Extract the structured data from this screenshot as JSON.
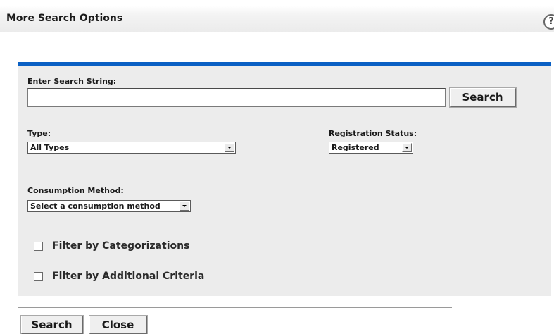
{
  "header": {
    "title": "More Search Options",
    "help_icon": "?"
  },
  "search": {
    "label": "Enter Search String:",
    "value": "",
    "placeholder": "",
    "button_label": "Search"
  },
  "type": {
    "label": "Type:",
    "selected": "All Types"
  },
  "registration_status": {
    "label": "Registration Status:",
    "selected": "Registered"
  },
  "consumption_method": {
    "label": "Consumption Method:",
    "selected": "Select a consumption method"
  },
  "filters": [
    {
      "label": "Filter by Categorizations",
      "checked": false
    },
    {
      "label": "Filter by Additional Criteria",
      "checked": false
    }
  ],
  "footer": {
    "search_label": "Search",
    "close_label": "Close"
  },
  "colors": {
    "accent": "#0a60c4",
    "panel_bg": "#ececec"
  }
}
